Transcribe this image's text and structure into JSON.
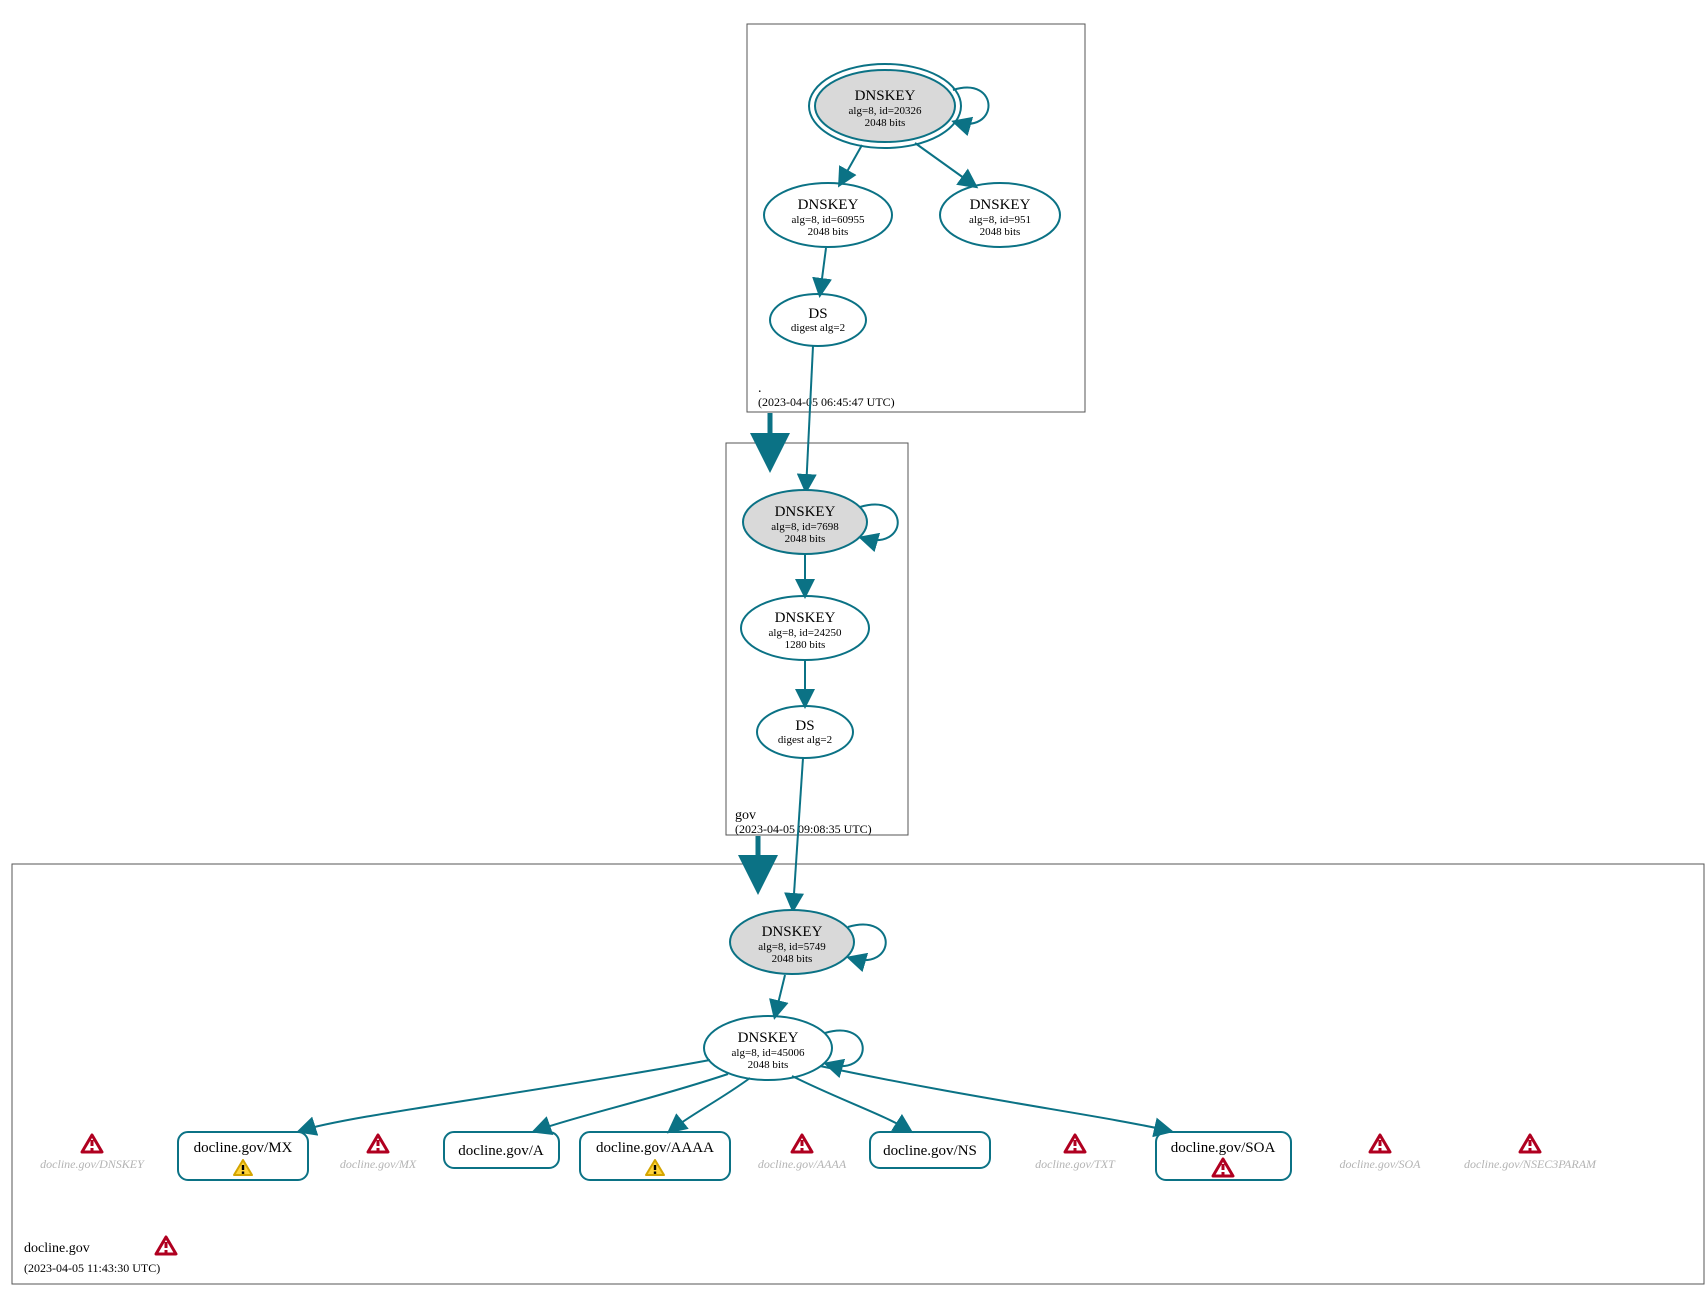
{
  "colors": {
    "edge": "#0b7285",
    "nodeFillGray": "#d9d9d9",
    "error": "#b00020",
    "warn": "#ffd43b"
  },
  "zones": {
    "root": {
      "label": ".",
      "timestamp": "(2023-04-05 06:45:47 UTC)"
    },
    "gov": {
      "label": "gov",
      "timestamp": "(2023-04-05 09:08:35 UTC)"
    },
    "docline": {
      "label": "docline.gov",
      "timestamp": "(2023-04-05 11:43:30 UTC)"
    }
  },
  "nodes": {
    "root_ksk": {
      "title": "DNSKEY",
      "line1": "alg=8, id=20326",
      "line2": "2048 bits"
    },
    "root_zsk1": {
      "title": "DNSKEY",
      "line1": "alg=8, id=60955",
      "line2": "2048 bits"
    },
    "root_zsk2": {
      "title": "DNSKEY",
      "line1": "alg=8, id=951",
      "line2": "2048 bits"
    },
    "root_ds": {
      "title": "DS",
      "line1": "digest alg=2",
      "line2": ""
    },
    "gov_ksk": {
      "title": "DNSKEY",
      "line1": "alg=8, id=7698",
      "line2": "2048 bits"
    },
    "gov_zsk": {
      "title": "DNSKEY",
      "line1": "alg=8, id=24250",
      "line2": "1280 bits"
    },
    "gov_ds": {
      "title": "DS",
      "line1": "digest alg=2",
      "line2": ""
    },
    "doc_ksk": {
      "title": "DNSKEY",
      "line1": "alg=8, id=5749",
      "line2": "2048 bits"
    },
    "doc_zsk": {
      "title": "DNSKEY",
      "line1": "alg=8, id=45006",
      "line2": "2048 bits"
    },
    "rr_mx": {
      "label": "docline.gov/MX"
    },
    "rr_a": {
      "label": "docline.gov/A"
    },
    "rr_aaaa": {
      "label": "docline.gov/AAAA"
    },
    "rr_ns": {
      "label": "docline.gov/NS"
    },
    "rr_soa": {
      "label": "docline.gov/SOA"
    }
  },
  "faded": {
    "dnskey": "docline.gov/DNSKEY",
    "mx": "docline.gov/MX",
    "aaaa": "docline.gov/AAAA",
    "txt": "docline.gov/TXT",
    "soa": "docline.gov/SOA",
    "nsec3": "docline.gov/NSEC3PARAM"
  }
}
